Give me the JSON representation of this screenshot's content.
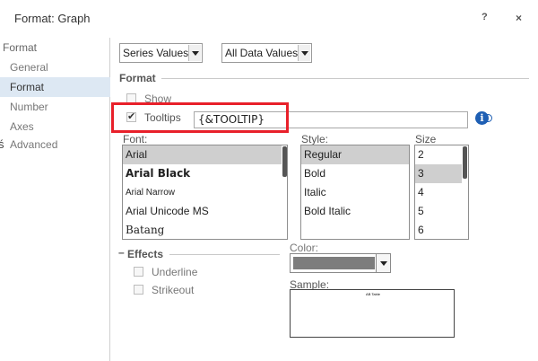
{
  "window": {
    "title": "Format: Graph",
    "help_label": "?",
    "close_label": "×"
  },
  "sidebar": {
    "root_label": "Format",
    "items": [
      {
        "label": "General",
        "selected": false
      },
      {
        "label": "Format",
        "selected": true
      },
      {
        "label": "Number",
        "selected": false
      },
      {
        "label": "Axes",
        "selected": false
      },
      {
        "label": "Advanced",
        "selected": false
      }
    ]
  },
  "toolbar": {
    "series_select": "Series Values",
    "data_select": "All Data Values"
  },
  "format_section": {
    "label": "Format",
    "show_label": "Show",
    "show_checked": false,
    "tooltips_label": "Tooltips",
    "tooltips_checked": true,
    "tooltip_value": "{&TOOLTIP}",
    "info_icon": "info-icon"
  },
  "font": {
    "label": "Font:",
    "items": [
      "Arial",
      "Arial Black",
      "Arial Narrow",
      "Arial Unicode MS",
      "Batang"
    ],
    "selected": "Arial"
  },
  "style": {
    "label": "Style:",
    "items": [
      "Regular",
      "Bold",
      "Italic",
      "Bold Italic"
    ],
    "selected": "Regular"
  },
  "size": {
    "label": "Size",
    "items": [
      "2",
      "3",
      "4",
      "5",
      "6"
    ],
    "selected": "3"
  },
  "effects": {
    "label": "Effects",
    "collapse_glyph": "–",
    "underline_label": "Underline",
    "underline_checked": false,
    "strikeout_label": "Strikeout",
    "strikeout_checked": false
  },
  "color": {
    "label": "Color:",
    "value": "#7d7d7d"
  },
  "sample": {
    "label": "Sample:",
    "text": "AB Table"
  },
  "colors": {
    "highlight_box": "#e8202a",
    "selected_nav": "#dde8f3",
    "info_icon": "#1e5fb4"
  }
}
